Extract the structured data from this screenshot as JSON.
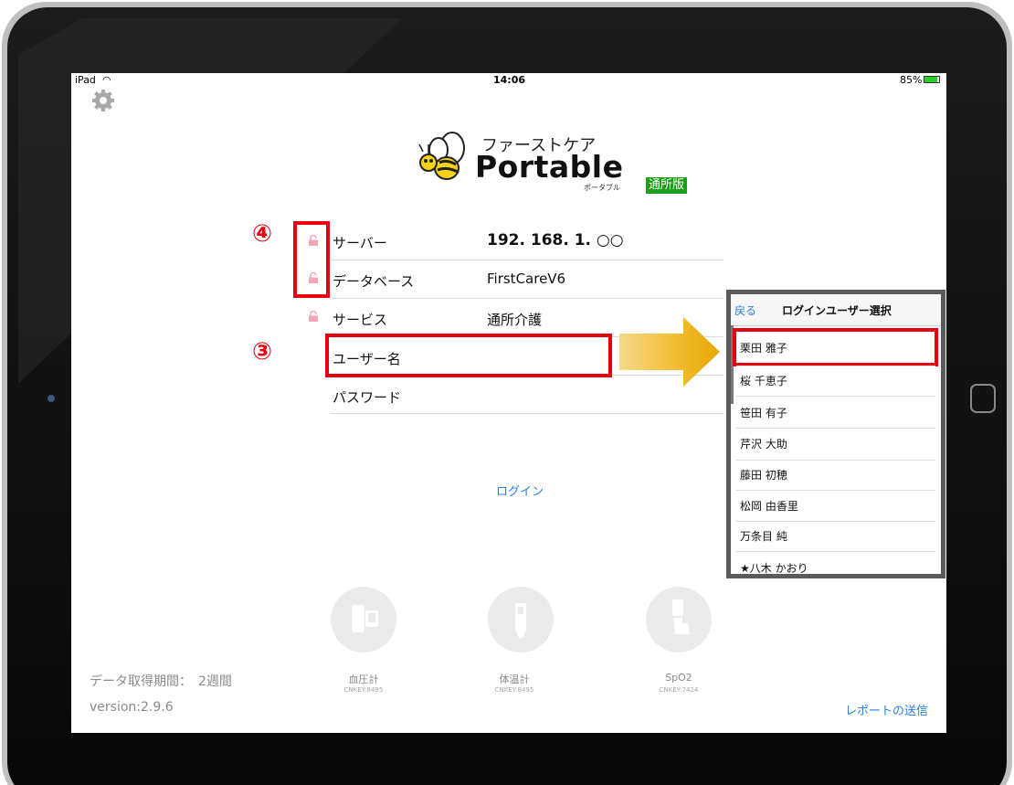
{
  "status_bar": {
    "device": "iPad",
    "time": "14:06",
    "battery": "85%"
  },
  "logo": {
    "title_kana": "ファーストケア",
    "title_main": "Portable",
    "subtitle_kana": "ポータブル",
    "badge": "通所版"
  },
  "form": {
    "rows": [
      {
        "label": "サーバー",
        "value": "192. 168. 1. ○○"
      },
      {
        "label": "データベース",
        "value": "FirstCareV6"
      },
      {
        "label": "サービス",
        "value": "通所介護"
      },
      {
        "label": "ユーザー名",
        "value": ""
      },
      {
        "label": "パスワード",
        "value": ""
      }
    ],
    "login_label": "ログイン"
  },
  "annotations": {
    "step4": "④",
    "step3": "③"
  },
  "devices": [
    {
      "name": "血圧計",
      "key": "CNKEY:8495"
    },
    {
      "name": "体温計",
      "key": "CNKEY:8495"
    },
    {
      "name": "SpO2",
      "key": "CNKEY:7424"
    }
  ],
  "footer": {
    "period": "データ取得期間：　2週間",
    "version": "version:2.9.6",
    "send_report": "レポートの送信"
  },
  "popup": {
    "back": "戻る",
    "title": "ログインユーザー選択",
    "users": [
      "栗田 雅子",
      "桜 千恵子",
      "笹田 有子",
      "芹沢 大助",
      "藤田 初穂",
      "松岡 由香里",
      "万条目 純",
      "★八木 かおり"
    ]
  },
  "colors": {
    "accent_red": "#e60012",
    "link_blue": "#2a7fe0",
    "badge_green": "#1aa01a",
    "arrow_gold": "#f2b514"
  }
}
